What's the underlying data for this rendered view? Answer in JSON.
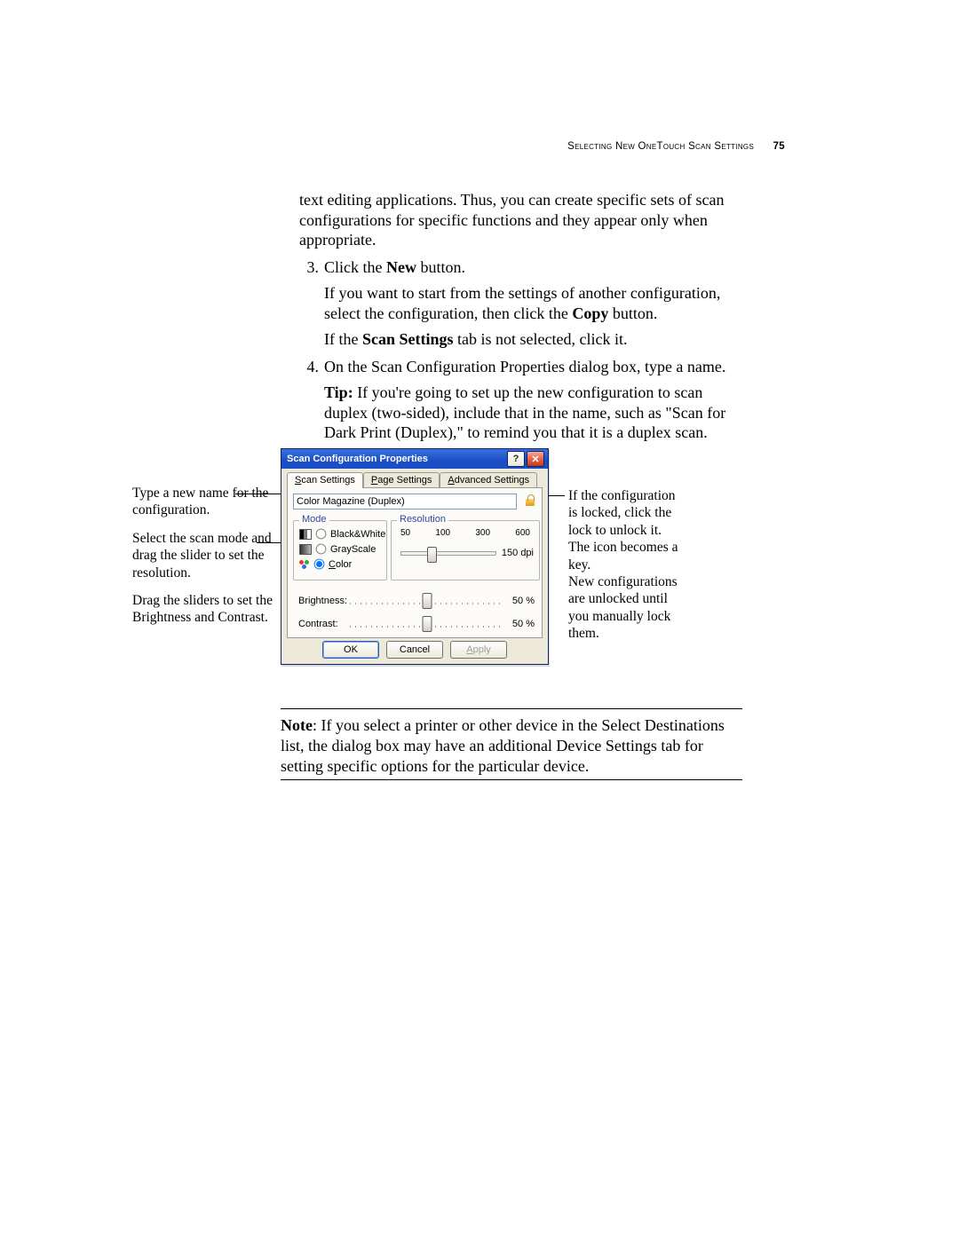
{
  "runhead": {
    "title": "Selecting New OneTouch Scan Settings",
    "page_number": "75"
  },
  "body": {
    "intro": "text editing applications. Thus, you can create specific sets of scan configurations for specific functions and they appear only when appropriate.",
    "step3_num": "3.",
    "step3_text_pre": "Click the ",
    "step3_bold": "New",
    "step3_text_post": " button.",
    "step3_cont_a_pre": "If you want to start from the settings of another configuration, select the configuration, then click the ",
    "step3_cont_a_bold": "Copy",
    "step3_cont_a_post": " button.",
    "step3_cont_b_pre": "If the ",
    "step3_cont_b_bold": "Scan Settings",
    "step3_cont_b_post": " tab is not selected, click it.",
    "step4_num": "4.",
    "step4_text": "On the Scan Configuration Properties dialog box, type a name.",
    "step4_tip_pre": "Tip:",
    "step4_tip_body": " If you're going to set up the new configuration to scan duplex (two-sided), include that in the name, such as \"Scan for Dark Print (Duplex),\" to remind you that it is a duplex scan."
  },
  "callouts_left": {
    "name": "Type a new name for the configuration.",
    "mode": "Select the scan mode and drag the slider to set the resolution.",
    "bc": "Drag the sliders to set the Brightness and Contrast."
  },
  "callouts_right": {
    "lock": "If the configuration is locked, click the lock to unlock it. The icon becomes a key.\nNew configurations are unlocked until you manually lock them."
  },
  "dialog": {
    "title": "Scan Configuration Properties",
    "help_glyph": "?",
    "close_glyph": "✕",
    "tabs": {
      "scan": "Scan Settings",
      "page": "Page Settings",
      "advanced": "Advanced Settings",
      "scan_ul": "S",
      "page_ul": "P",
      "adv_ul": "A"
    },
    "config_name": "Color Magazine (Duplex)",
    "mode_legend": "Mode",
    "mode_bw": "Black&White",
    "mode_gs": "GrayScale",
    "mode_color": "Color",
    "mode_color_ul": "C",
    "reso_legend": "Resolution",
    "reso_ticks": {
      "a": "50",
      "b": "100",
      "c": "300",
      "d": "600"
    },
    "reso_value": "150 dpi",
    "brightness_label": "Brightness:",
    "brightness_value": "50 %",
    "contrast_label": "Contrast:",
    "contrast_value": "50 %",
    "ok": "OK",
    "cancel": "Cancel",
    "apply": "Apply",
    "apply_ul": "A"
  },
  "note": {
    "label": "Note",
    "text": ":  If you select a printer or other device in the Select Destinations list, the dialog box may have an additional Device Settings tab for setting specific options for the particular device."
  }
}
